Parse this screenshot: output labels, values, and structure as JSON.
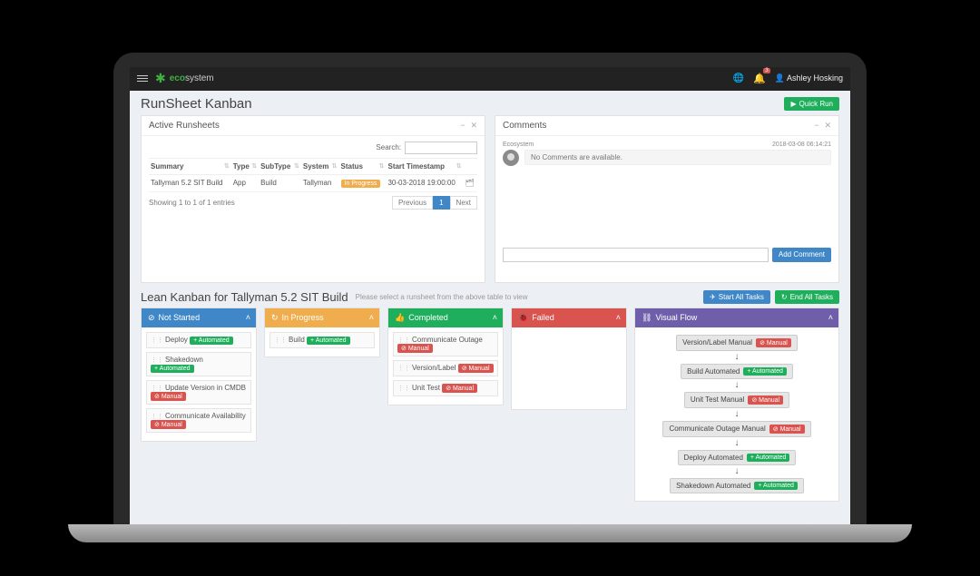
{
  "topbar": {
    "brand_eco": "eco",
    "brand_system": "system",
    "notif_count": "3",
    "username": "Ashley Hosking"
  },
  "page": {
    "title": "RunSheet Kanban",
    "quick_run": "Quick Run"
  },
  "runsheets": {
    "title": "Active Runsheets",
    "search_label": "Search:",
    "columns": {
      "summary": "Summary",
      "type": "Type",
      "subtype": "SubType",
      "system": "System",
      "status": "Status",
      "start": "Start Timestamp"
    },
    "row": {
      "summary": "Tallyman 5.2 SIT Build",
      "type": "App",
      "subtype": "Build",
      "system": "Tallyman",
      "status": "In Progress",
      "start": "30-03-2018 19:00:00"
    },
    "info": "Showing 1 to 1 of 1 entries",
    "prev": "Previous",
    "page1": "1",
    "next": "Next"
  },
  "comments": {
    "title": "Comments",
    "author": "Ecosystem",
    "time": "2018-03-08 06:14:21",
    "msg": "No Comments are available.",
    "add": "Add Comment"
  },
  "kanban": {
    "title": "Lean Kanban for Tallyman 5.2 SIT Build",
    "subtitle": "Please select a runsheet from the above table to view",
    "start_all": "Start All Tasks",
    "end_all": "End All Tasks",
    "cols": {
      "not_started": "Not Started",
      "in_progress": "In Progress",
      "completed": "Completed",
      "failed": "Failed",
      "visual_flow": "Visual Flow"
    },
    "not_started": {
      "c1": "Deploy",
      "t1": "Automated",
      "c2": "Shakedown",
      "t2": "Automated",
      "c3": "Update Version in CMDB",
      "t3": "Manual",
      "c4": "Communicate Availability",
      "t4": "Manual"
    },
    "in_progress": {
      "c1": "Build",
      "t1": "Automated"
    },
    "completed": {
      "c1": "Communicate Outage",
      "t1": "Manual",
      "c2": "Version/Label",
      "t2": "Manual",
      "c3": "Unit Test",
      "t3": "Manual"
    },
    "visual_flow": {
      "n1": "Version/Label Manual",
      "b1": "Manual",
      "n2": "Build Automated",
      "b2": "Automated",
      "n3": "Unit Test Manual",
      "b3": "Manual",
      "n4": "Communicate Outage Manual",
      "b4": "Manual",
      "n5": "Deploy Automated",
      "b5": "Automated",
      "n6": "Shakedown Automated",
      "b6": "Automated"
    },
    "badge_automated_icon": "+",
    "badge_manual_icon": "⊘"
  }
}
